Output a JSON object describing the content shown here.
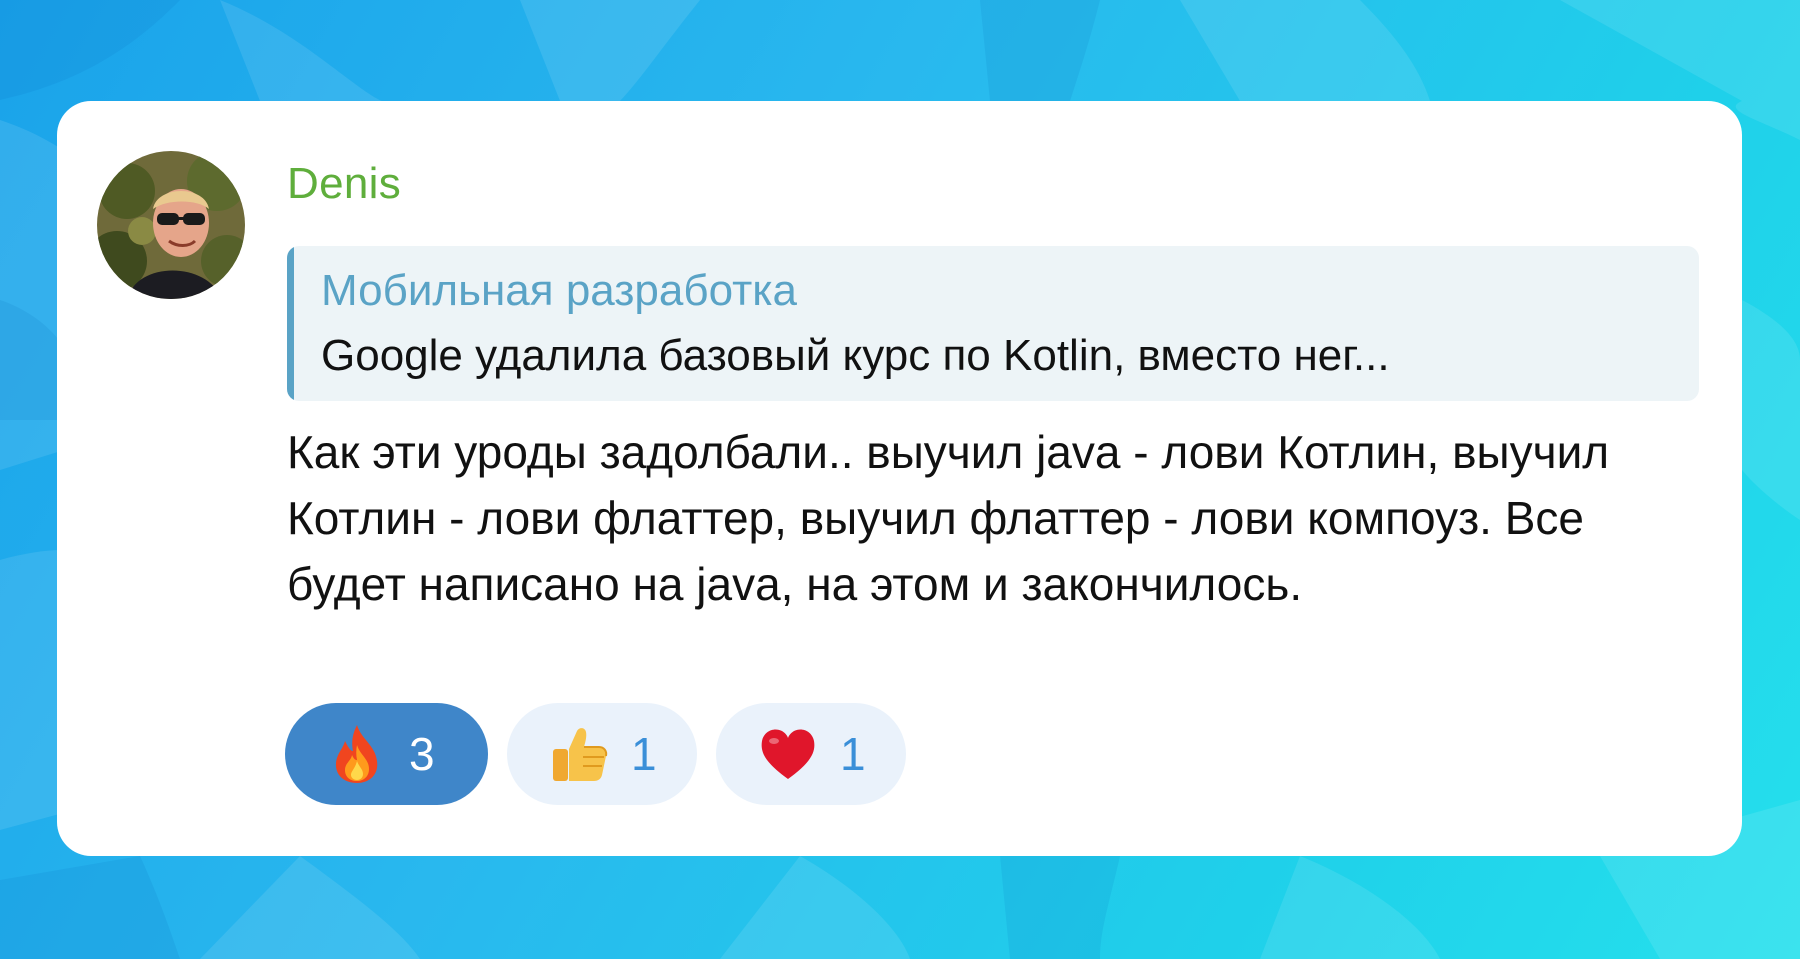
{
  "message": {
    "author": "Denis",
    "reply": {
      "title": "Мобильная разработка",
      "text": "Google удалила базовый курс по Kotlin, вместо нег..."
    },
    "text": "Как эти уроды задолбали.. выучил java - лови Котлин, выучил Котлин - лови флаттер, выучил флаттер - лови компоуз. Все будет написано на java, на этом и закончилось.",
    "reactions": [
      {
        "emoji": "fire-icon",
        "count": "3",
        "active": true
      },
      {
        "emoji": "thumbs-up-icon",
        "count": "1",
        "active": false
      },
      {
        "emoji": "heart-icon",
        "count": "1",
        "active": false
      }
    ]
  },
  "colors": {
    "author": "#5fae3c",
    "reply_accent": "#5aa3c6",
    "reaction_active": "#3f86c9",
    "reaction_inactive": "#eaf2fb"
  }
}
